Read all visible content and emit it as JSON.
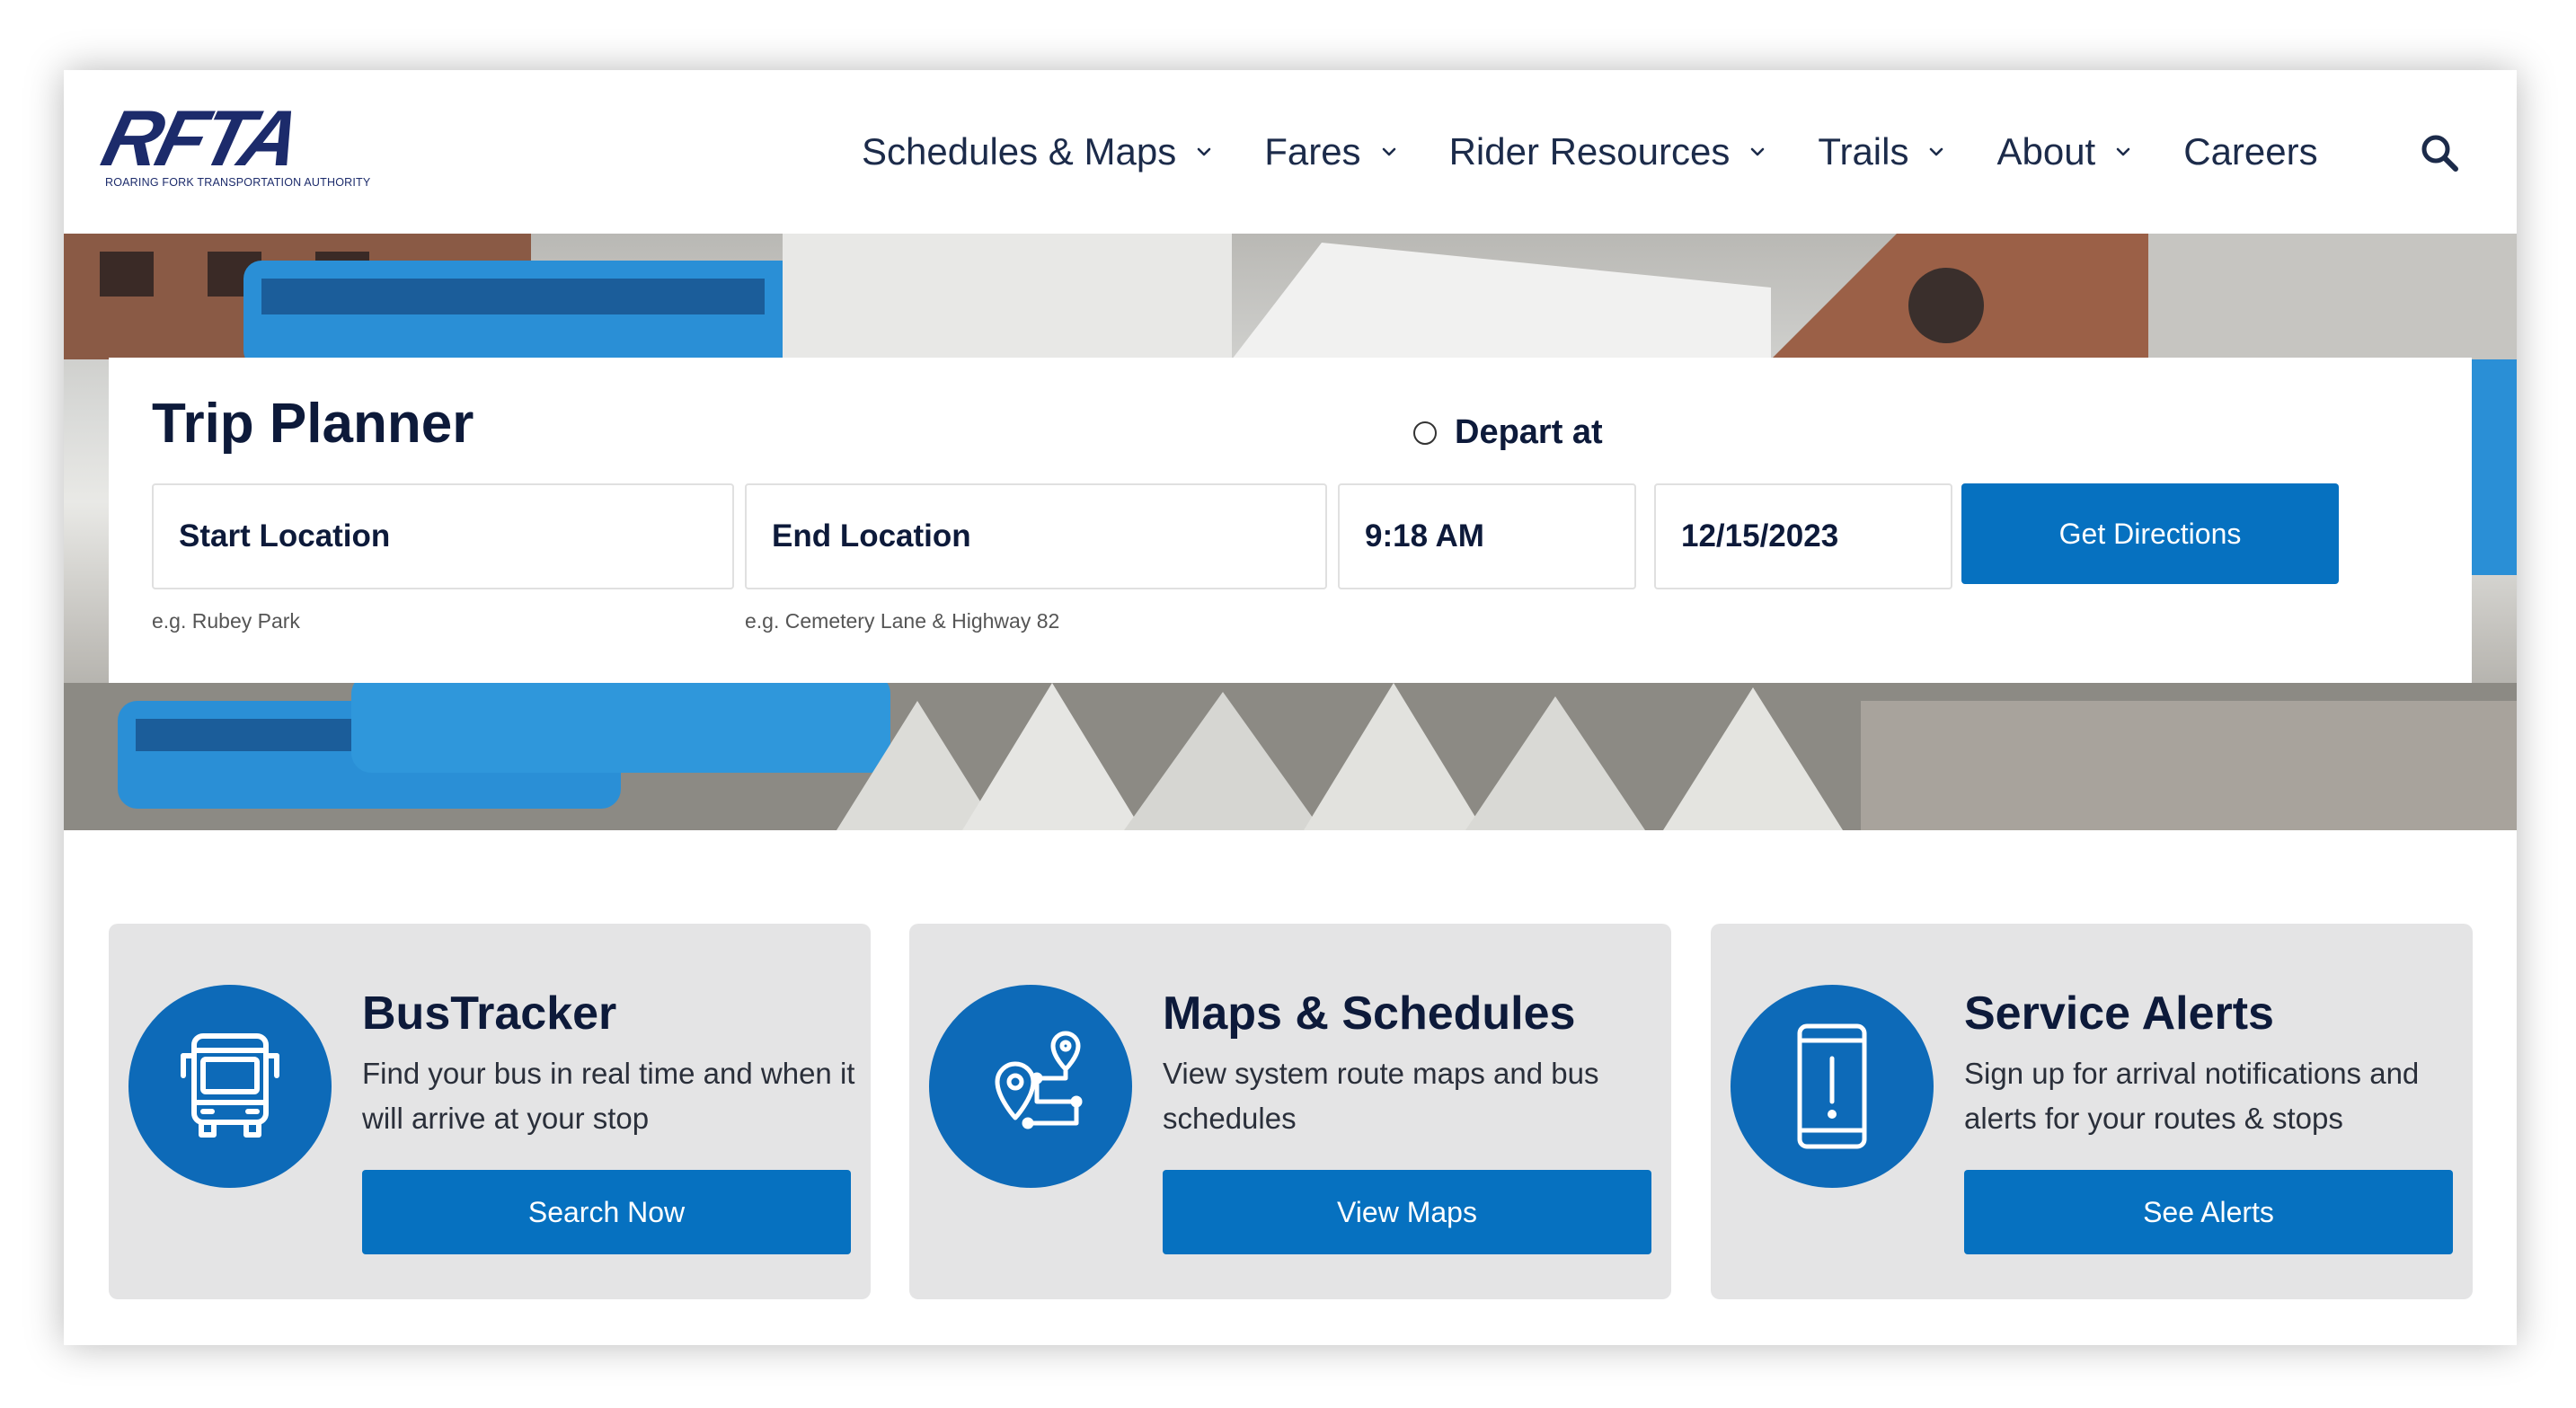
{
  "logo": {
    "wordmark": "RFTA",
    "subtitle": "ROARING FORK TRANSPORTATION AUTHORITY"
  },
  "nav": {
    "items": [
      {
        "label": "Schedules & Maps",
        "has_dropdown": true
      },
      {
        "label": "Fares",
        "has_dropdown": true
      },
      {
        "label": "Rider Resources",
        "has_dropdown": true
      },
      {
        "label": "Trails",
        "has_dropdown": true
      },
      {
        "label": "About",
        "has_dropdown": true
      },
      {
        "label": "Careers",
        "has_dropdown": false
      }
    ],
    "search_icon": "search-icon"
  },
  "trip_planner": {
    "title": "Trip Planner",
    "depart_label": "Depart at",
    "start_location": "Start Location",
    "start_hint": "e.g. Rubey Park",
    "end_location": "End Location",
    "end_hint": "e.g. Cemetery Lane & Highway 82",
    "time": "9:18 AM",
    "date": "12/15/2023",
    "submit_label": "Get Directions"
  },
  "cards": [
    {
      "icon": "bus-icon",
      "title": "BusTracker",
      "description": "Find your bus in real time and when it will arrive at your stop",
      "button": "Search Now"
    },
    {
      "icon": "route-map-icon",
      "title": "Maps & Schedules",
      "description": "View system route maps and bus schedules",
      "button": "View Maps"
    },
    {
      "icon": "phone-alert-icon",
      "title": "Service Alerts",
      "description": "Sign up for arrival notifications and alerts for your routes & stops",
      "button": "See Alerts"
    }
  ],
  "colors": {
    "brand_navy": "#1c2b6b",
    "button_blue": "#0671c0",
    "icon_circle_blue": "#0d6ab8",
    "card_bg": "#e4e4e5"
  }
}
